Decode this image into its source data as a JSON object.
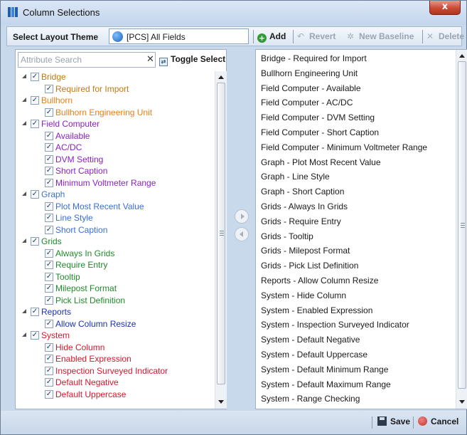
{
  "window": {
    "title": "Column Selections",
    "close_label": "x"
  },
  "toolbar": {
    "layout_label": "Select Layout Theme",
    "theme_value": "[PCS] All Fields",
    "add_label": "Add",
    "revert_label": "Revert",
    "new_baseline_label": "New Baseline",
    "delete_label": "Delete"
  },
  "attribute_search": {
    "placeholder": "Attribute Search",
    "toggle_label": "Toggle Select"
  },
  "tree": [
    {
      "label": "Bridge",
      "level": 0,
      "color": "#c27a0e",
      "checked": true
    },
    {
      "label": "Required for Import",
      "level": 1,
      "color": "#c27a0e",
      "checked": true
    },
    {
      "label": "Bullhorn",
      "level": 0,
      "color": "#f07d16",
      "checked": true
    },
    {
      "label": "Bullhorn Engineering Unit",
      "level": 1,
      "color": "#f07d16",
      "checked": true
    },
    {
      "label": "Field Computer",
      "level": 0,
      "color": "#8a1fc8",
      "checked": true
    },
    {
      "label": "Available",
      "level": 1,
      "color": "#8a1fc8",
      "checked": true
    },
    {
      "label": "AC/DC",
      "level": 1,
      "color": "#8a1fc8",
      "checked": true
    },
    {
      "label": "DVM Setting",
      "level": 1,
      "color": "#8a1fc8",
      "checked": true
    },
    {
      "label": "Short Caption",
      "level": 1,
      "color": "#8a1fc8",
      "checked": true
    },
    {
      "label": "Minimum Voltmeter Range",
      "level": 1,
      "color": "#8a1fc8",
      "checked": true
    },
    {
      "label": "Graph",
      "level": 0,
      "color": "#3a6fd8",
      "checked": true
    },
    {
      "label": "Plot Most Recent Value",
      "level": 1,
      "color": "#3a6fd8",
      "checked": true
    },
    {
      "label": "Line Style",
      "level": 1,
      "color": "#3a6fd8",
      "checked": true
    },
    {
      "label": "Short Caption",
      "level": 1,
      "color": "#3a6fd8",
      "checked": true
    },
    {
      "label": "Grids",
      "level": 0,
      "color": "#1f8a2a",
      "checked": true
    },
    {
      "label": "Always In Grids",
      "level": 1,
      "color": "#1f8a2a",
      "checked": true
    },
    {
      "label": "Require Entry",
      "level": 1,
      "color": "#1f8a2a",
      "checked": true
    },
    {
      "label": "Tooltip",
      "level": 1,
      "color": "#1f8a2a",
      "checked": true
    },
    {
      "label": "Milepost Format",
      "level": 1,
      "color": "#1f8a2a",
      "checked": true
    },
    {
      "label": "Pick List Definition",
      "level": 1,
      "color": "#1f8a2a",
      "checked": true
    },
    {
      "label": "Reports",
      "level": 0,
      "color": "#1a2fbf",
      "checked": true
    },
    {
      "label": "Allow Column Resize",
      "level": 1,
      "color": "#1a2fbf",
      "checked": true
    },
    {
      "label": "System",
      "level": 0,
      "color": "#d8162c",
      "checked": true
    },
    {
      "label": "Hide Column",
      "level": 1,
      "color": "#d8162c",
      "checked": true
    },
    {
      "label": "Enabled Expression",
      "level": 1,
      "color": "#d8162c",
      "checked": true
    },
    {
      "label": "Inspection Surveyed Indicator",
      "level": 1,
      "color": "#d8162c",
      "checked": true
    },
    {
      "label": "Default Negative",
      "level": 1,
      "color": "#d8162c",
      "checked": true
    },
    {
      "label": "Default Uppercase",
      "level": 1,
      "color": "#d8162c",
      "checked": true
    }
  ],
  "selected_columns": [
    "Bridge - Required for Import",
    "Bullhorn Engineering Unit",
    "Field Computer - Available",
    "Field Computer - AC/DC",
    "Field Computer - DVM Setting",
    "Field Computer - Short Caption",
    "Field Computer - Minimum Voltmeter Range",
    "Graph - Plot Most Recent Value",
    "Graph - Line Style",
    "Graph - Short Caption",
    "Grids - Always In Grids",
    "Grids - Require Entry",
    "Grids - Tooltip",
    "Grids - Milepost Format",
    "Grids - Pick List Definition",
    "Reports - Allow Column Resize",
    "System - Hide Column",
    "System - Enabled Expression",
    "System - Inspection Surveyed Indicator",
    "System - Default Negative",
    "System - Default Uppercase",
    "System - Default Minimum Range",
    "System - Default Maximum Range",
    "System - Range Checking"
  ],
  "footer": {
    "save_label": "Save",
    "cancel_label": "Cancel"
  }
}
